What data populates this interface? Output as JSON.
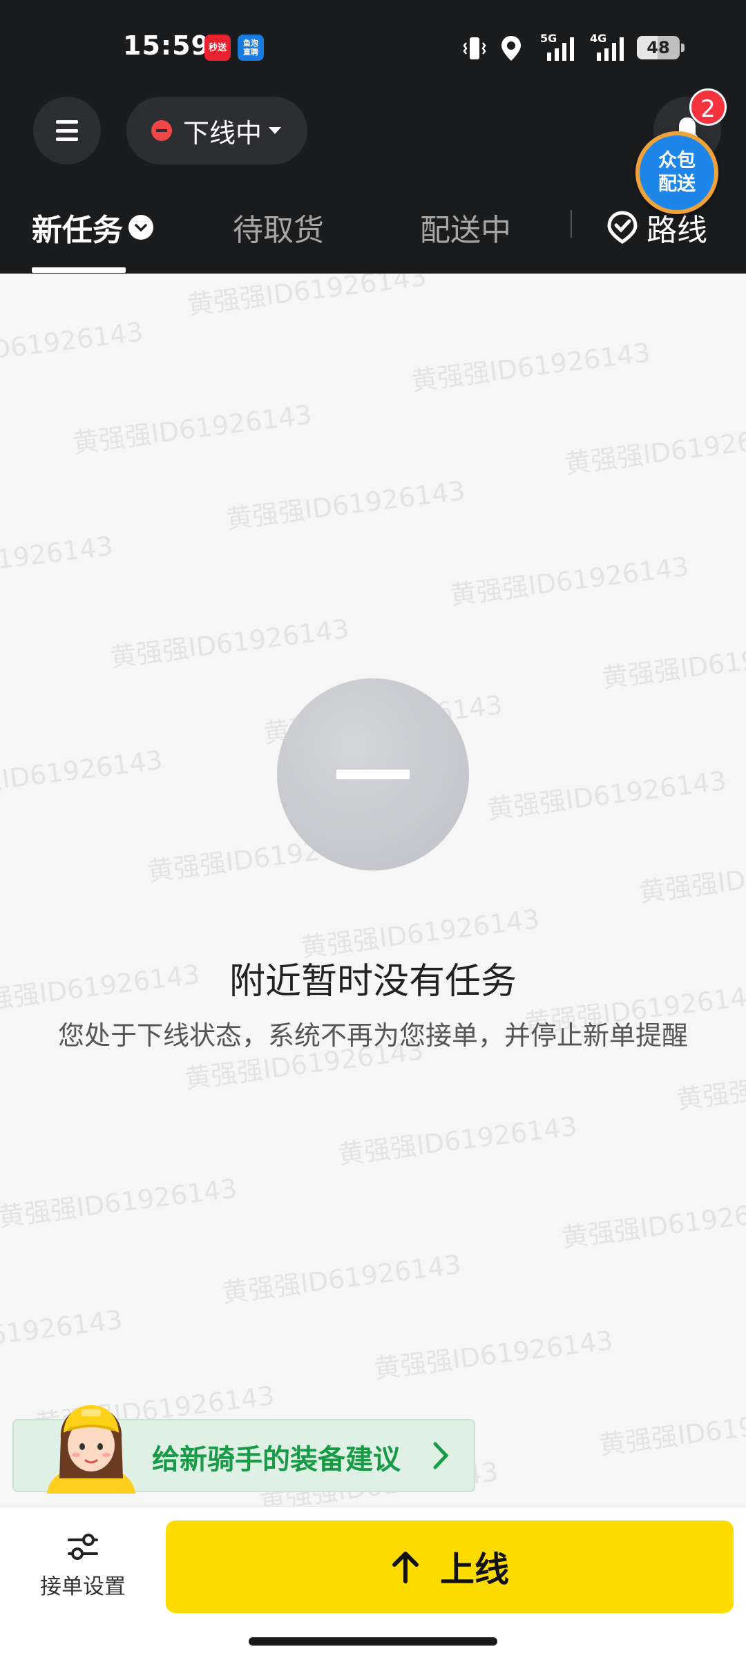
{
  "status_bar": {
    "time": "15:59",
    "app_badges": [
      {
        "name": "miaosong-app-icon",
        "text": "秒送",
        "color": "#e8232f"
      },
      {
        "name": "yupao-app-icon",
        "text": "鱼泡直聘",
        "color": "#1a7ce0"
      }
    ],
    "network_1": "5G",
    "network_2": "4G",
    "battery": "48",
    "battery_level": 0.48
  },
  "header": {
    "status_label": "下线中",
    "notification_count": "2",
    "crowd_delivery": "众包配送"
  },
  "tabs": [
    {
      "label": "新任务",
      "active": true
    },
    {
      "label": "待取货",
      "active": false
    },
    {
      "label": "配送中",
      "active": false
    },
    {
      "label": "路线",
      "active": false
    }
  ],
  "watermark": "黄强强ID61926143",
  "empty_state": {
    "title": "附近暂时没有任务",
    "description": "您处于下线状态，系统不再为您接单，并停止新单提醒"
  },
  "equip_banner": {
    "text": "给新骑手的装备建议"
  },
  "bottom": {
    "settings_label": "接单设置",
    "online_label": "上线"
  },
  "colors": {
    "header_bg": "#1b1c1e",
    "accent_yellow": "#ffdc00",
    "badge_red": "#f5333f",
    "offline_red": "#f04646",
    "banner_green": "#199a47"
  }
}
